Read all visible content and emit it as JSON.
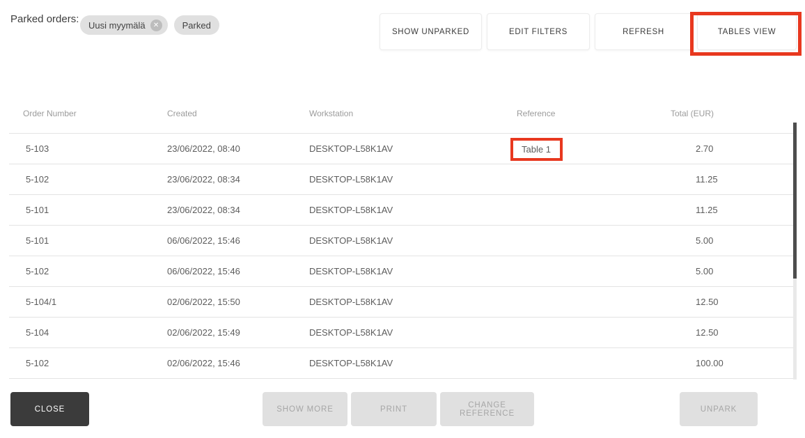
{
  "header": {
    "label": "Parked orders:"
  },
  "filters": {
    "chips": [
      {
        "label": "Uusi myymälä",
        "removable": true
      },
      {
        "label": "Parked",
        "removable": false
      }
    ]
  },
  "toolbar": {
    "buttons": [
      {
        "label": "SHOW UNPARKED",
        "highlighted": false
      },
      {
        "label": "EDIT FILTERS",
        "highlighted": false
      },
      {
        "label": "REFRESH",
        "highlighted": false
      },
      {
        "label": "TABLES VIEW",
        "highlighted": true
      }
    ]
  },
  "table": {
    "columns": [
      "Order Number",
      "Created",
      "Workstation",
      "Reference",
      "Total (EUR)"
    ],
    "rows": [
      {
        "order_number": "5-103",
        "created": "23/06/2022, 08:40",
        "workstation": "DESKTOP-L58K1AV",
        "reference": "Table 1",
        "reference_highlighted": true,
        "total": "2.70"
      },
      {
        "order_number": "5-102",
        "created": "23/06/2022, 08:34",
        "workstation": "DESKTOP-L58K1AV",
        "reference": "",
        "reference_highlighted": false,
        "total": "11.25"
      },
      {
        "order_number": "5-101",
        "created": "23/06/2022, 08:34",
        "workstation": "DESKTOP-L58K1AV",
        "reference": "",
        "reference_highlighted": false,
        "total": "11.25"
      },
      {
        "order_number": "5-101",
        "created": "06/06/2022, 15:46",
        "workstation": "DESKTOP-L58K1AV",
        "reference": "",
        "reference_highlighted": false,
        "total": "5.00"
      },
      {
        "order_number": "5-102",
        "created": "06/06/2022, 15:46",
        "workstation": "DESKTOP-L58K1AV",
        "reference": "",
        "reference_highlighted": false,
        "total": "5.00"
      },
      {
        "order_number": "5-104/1",
        "created": "02/06/2022, 15:50",
        "workstation": "DESKTOP-L58K1AV",
        "reference": "",
        "reference_highlighted": false,
        "total": "12.50"
      },
      {
        "order_number": "5-104",
        "created": "02/06/2022, 15:49",
        "workstation": "DESKTOP-L58K1AV",
        "reference": "",
        "reference_highlighted": false,
        "total": "12.50"
      },
      {
        "order_number": "5-102",
        "created": "02/06/2022, 15:46",
        "workstation": "DESKTOP-L58K1AV",
        "reference": "",
        "reference_highlighted": false,
        "total": "100.00"
      }
    ]
  },
  "footer": {
    "close": {
      "label": "CLOSE"
    },
    "disabled_buttons": [
      {
        "label": "SHOW MORE"
      },
      {
        "label": "PRINT"
      },
      {
        "label": "CHANGE REFERENCE"
      }
    ],
    "unpark": {
      "label": "UNPARK",
      "disabled": true
    }
  },
  "annotations": {
    "highlight_color": "#e8381f",
    "targets": [
      "tables-view-button",
      "reference-cell-table-1"
    ]
  },
  "colors": {
    "close_button_bg": "#3b3b3b",
    "chip_bg": "#e0e0e0",
    "disabled_button_bg": "#e0e0e0",
    "disabled_button_text": "#a6a6a6",
    "column_header_text": "#9b9b9b",
    "cell_text": "#5c5c5c",
    "separator": "#e3e3e3",
    "scrollbar_thumb": "#4d4d4d",
    "scrollbar_track": "#e9e9e9"
  }
}
